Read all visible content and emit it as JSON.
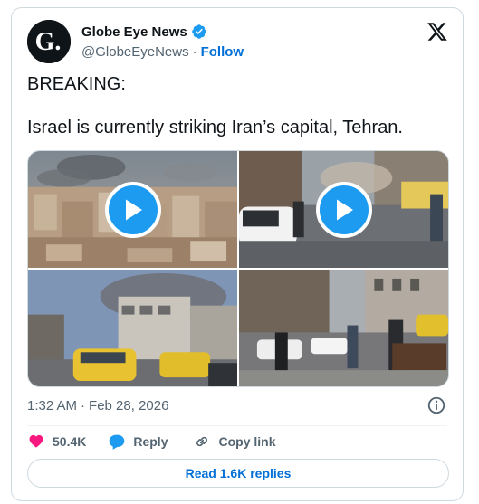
{
  "author": {
    "display_name": "Globe Eye News",
    "handle": "@GlobeEyeNews",
    "follow_label": "Follow",
    "avatar_letter": "G."
  },
  "tweet": {
    "text": "BREAKING:\n\nIsrael is currently striking Iran’s capital, Tehran."
  },
  "media": [
    {
      "kind": "video",
      "description": "smoke over city skyline"
    },
    {
      "kind": "video",
      "description": "street with parked cars and smoke"
    },
    {
      "kind": "photo",
      "description": "smoke behind building, yellow taxis"
    },
    {
      "kind": "photo",
      "description": "people on street square"
    }
  ],
  "meta": {
    "time": "1:32 AM",
    "separator": "·",
    "date": "Feb 28, 2026"
  },
  "actions": {
    "like_count": "50.4K",
    "reply_label": "Reply",
    "copy_link_label": "Copy link"
  },
  "replies_button": "Read 1.6K replies",
  "colors": {
    "accent": "#1d9bf0",
    "link": "#006fd6",
    "like": "#f91880",
    "muted": "#536471"
  },
  "icons": [
    "verified-icon",
    "x-logo-icon",
    "play-icon",
    "info-icon",
    "heart-icon",
    "reply-bubble-icon",
    "link-icon"
  ]
}
